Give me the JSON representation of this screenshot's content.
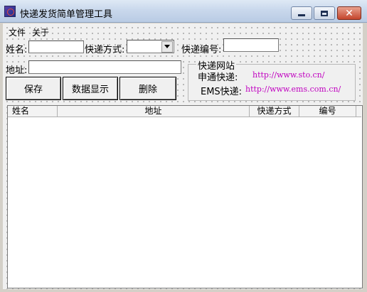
{
  "window": {
    "title": "快递发货简单管理工具"
  },
  "menu": [
    {
      "label": "文件"
    },
    {
      "label": "关于"
    }
  ],
  "form": {
    "name_label": "姓名:",
    "name_value": "",
    "courier_label": "快递方式:",
    "courier_selected": "",
    "number_label": "快递编号:",
    "number_value": "",
    "address_label": "地址:",
    "address_value": ""
  },
  "buttons": {
    "save": "保存",
    "show_data": "数据显示",
    "delete": "删除"
  },
  "courier_sites": {
    "caption": "快递网站",
    "sto_label": "申通快递:",
    "sto_url": "http://www.sto.cn/",
    "ems_label": "EMS快递:",
    "ems_url": "http://www.ems.com.cn/"
  },
  "table": {
    "columns": [
      "姓名",
      "地址",
      "快递方式",
      "编号"
    ],
    "rows": []
  }
}
